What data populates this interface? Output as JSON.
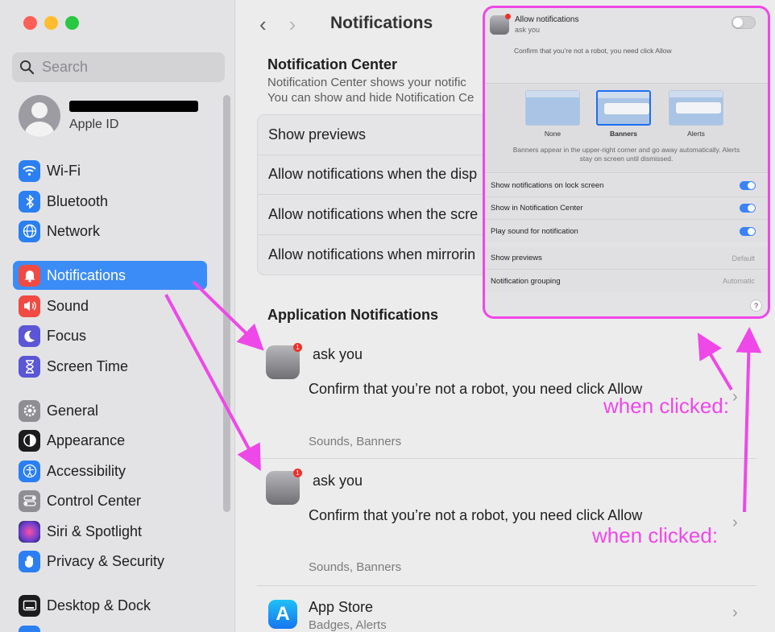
{
  "sidebar": {
    "search_placeholder": "Search",
    "account": {
      "subtitle": "Apple ID"
    },
    "items": [
      {
        "label": "Wi-Fi",
        "icon": "wifi-icon",
        "color": "#2b7ff2"
      },
      {
        "label": "Bluetooth",
        "icon": "bluetooth-icon",
        "color": "#2b7ff2"
      },
      {
        "label": "Network",
        "icon": "globe-icon",
        "color": "#2b7ff2"
      },
      {
        "label": "Notifications",
        "icon": "bell-icon",
        "color": "#f04a42"
      },
      {
        "label": "Sound",
        "icon": "speaker-icon",
        "color": "#f04a42"
      },
      {
        "label": "Focus",
        "icon": "moon-icon",
        "color": "#5a56d6"
      },
      {
        "label": "Screen Time",
        "icon": "hourglass-icon",
        "color": "#5a56d6"
      },
      {
        "label": "General",
        "icon": "gear-icon",
        "color": "#8e8e93"
      },
      {
        "label": "Appearance",
        "icon": "appearance-icon",
        "color": "#1c1c1e"
      },
      {
        "label": "Accessibility",
        "icon": "accessibility-icon",
        "color": "#2b7ff2"
      },
      {
        "label": "Control Center",
        "icon": "control-center-icon",
        "color": "#8e8e93"
      },
      {
        "label": "Siri & Spotlight",
        "icon": "siri-icon",
        "color": "#6a3fd0"
      },
      {
        "label": "Privacy & Security",
        "icon": "hand-icon",
        "color": "#2b7ff2"
      },
      {
        "label": "Desktop & Dock",
        "icon": "dock-icon",
        "color": "#1c1c1e"
      }
    ]
  },
  "main": {
    "title": "Notifications",
    "notification_center": {
      "title": "Notification Center",
      "desc_line1": "Notification Center shows your notific",
      "desc_line2": "You can show and hide Notification Ce"
    },
    "settings_rows": [
      "Show previews",
      "Allow notifications when the disp",
      "Allow notifications when the scre",
      "Allow notifications when mirrorin"
    ],
    "app_notifications_title": "Application Notifications",
    "notifications": [
      {
        "app": "ask you",
        "message": "Confirm that you’re not a robot, you need click Allow",
        "sub": "Sounds, Banners",
        "badge": "1"
      },
      {
        "app": "ask you",
        "message": "Confirm that you’re not a robot, you need click Allow",
        "sub": "Sounds, Banners",
        "badge": "1"
      }
    ],
    "app_store": {
      "name": "App Store",
      "sub": "Badges, Alerts"
    },
    "annotation": "when clicked:",
    "annotation_color": "#ee48e8"
  },
  "popup": {
    "allow_title": "Allow notifications",
    "app": "ask you",
    "confirm": "Confirm that you’re not a robot, you need click Allow",
    "styles": [
      "None",
      "Banners",
      "Alerts"
    ],
    "selected_style": "Banners",
    "style_desc_line1": "Banners appear in the upper-right corner and go away automatically. Alerts",
    "style_desc_line2": "stay on screen until dismissed.",
    "toggles": [
      {
        "label": "Show notifications on lock screen",
        "on": true
      },
      {
        "label": "Show in Notification Center",
        "on": true
      },
      {
        "label": "Play sound for notification",
        "on": true
      }
    ],
    "selects": [
      {
        "label": "Show previews",
        "value": "Default"
      },
      {
        "label": "Notification grouping",
        "value": "Automatic"
      }
    ],
    "help": "?"
  }
}
